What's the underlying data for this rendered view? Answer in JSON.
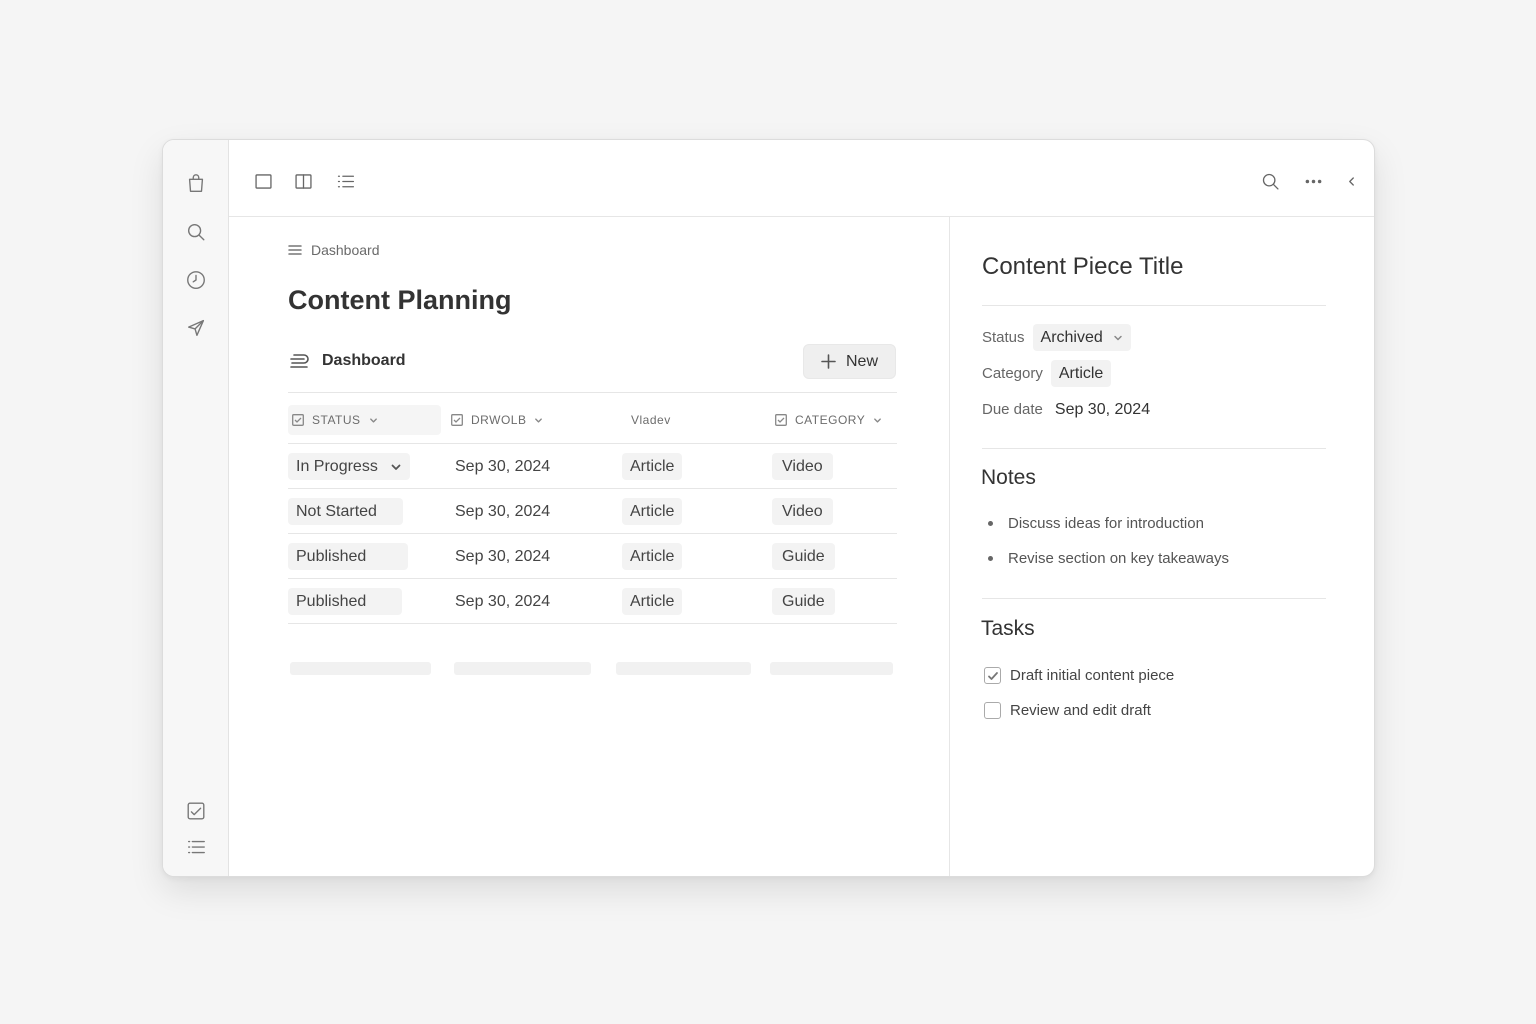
{
  "left_rail": {
    "top_icons": [
      "shopping-bag-icon",
      "search-icon",
      "clock-icon",
      "send-icon"
    ],
    "bottom_icons": [
      "checkbox-icon",
      "settings-list-icon"
    ]
  },
  "toolbar": {
    "left_icons": [
      "single-pane-icon",
      "split-pane-icon",
      "list-view-icon"
    ],
    "right_icons": [
      "search-icon",
      "more-icon",
      "collapse-icon"
    ]
  },
  "main": {
    "breadcrumb": "Dashboard",
    "title": "Content Planning",
    "view_tab": "Dashboard",
    "new_button": "New",
    "columns": [
      {
        "label": "STATUS",
        "icon": "checkbox-icon",
        "dropdown": true
      },
      {
        "label": "DRWOLB",
        "icon": "checkbox-icon",
        "dropdown": true
      },
      {
        "label": "Vladev",
        "icon": "",
        "dropdown": false
      },
      {
        "label": "CATEGORY",
        "icon": "checkbox-icon",
        "dropdown": true
      }
    ],
    "rows": [
      {
        "status": "In Progress",
        "date": "Sep 30, 2024",
        "type": "Article",
        "category": "Video"
      },
      {
        "status": "Not Started",
        "date": "Sep 30, 2024",
        "type": "Article",
        "category": "Video"
      },
      {
        "status": "Published",
        "date": "Sep 30, 2024",
        "type": "Article",
        "category": "Guide"
      },
      {
        "status": "Published",
        "date": "Sep 30, 2024",
        "type": "Article",
        "category": "Guide"
      }
    ]
  },
  "detail": {
    "title": "Content Piece Title",
    "properties": {
      "status_label": "Status",
      "status_value": "Archived",
      "category_label": "Category",
      "category_value": "Article",
      "due_label": "Due date",
      "due_value": "Sep 30, 2024"
    },
    "notes_heading": "Notes",
    "notes": [
      "Discuss ideas for introduction",
      "Revise section on key takeaways"
    ],
    "tasks_heading": "Tasks",
    "tasks": [
      {
        "label": "Draft initial content piece",
        "checked": true
      },
      {
        "label": "Review and edit draft",
        "checked": false
      }
    ]
  }
}
